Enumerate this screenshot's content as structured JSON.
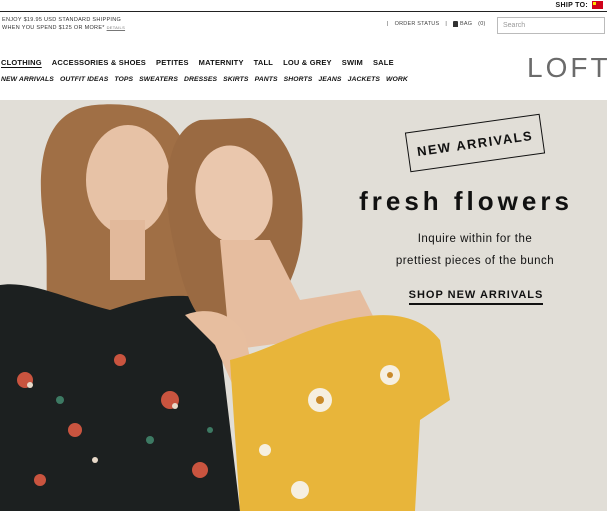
{
  "topbar": {
    "ship_to": "SHIP TO:"
  },
  "promo": {
    "line1": "ENJOY $19.95 USD STANDARD SHIPPING",
    "line2": "WHEN YOU SPEND $125 OR MORE*",
    "details": "DETAILS"
  },
  "utility": {
    "order_status": "ORDER STATUS",
    "bag": "BAG",
    "bag_count": "(0)",
    "search_placeholder": "Search"
  },
  "brand": {
    "logo": "LOFT"
  },
  "nav_primary": [
    "CLOTHING",
    "ACCESSORIES & SHOES",
    "PETITES",
    "MATERNITY",
    "TALL",
    "LOU & GREY",
    "SWIM",
    "SALE"
  ],
  "nav_secondary": [
    "NEW ARRIVALS",
    "OUTFIT IDEAS",
    "TOPS",
    "SWEATERS",
    "DRESSES",
    "SKIRTS",
    "PANTS",
    "SHORTS",
    "JEANS",
    "JACKETS",
    "WORK"
  ],
  "hero": {
    "badge": "NEW ARRIVALS",
    "headline": "fresh flowers",
    "subline1": "Inquire within for the",
    "subline2": "prettiest pieces of the bunch",
    "cta": "SHOP NEW ARRIVALS"
  },
  "colors": {
    "hero_bg": "#e1ded7",
    "dress_yellow": "#e8b53a",
    "dress_black": "#1c2020",
    "flag_red": "#d0021b"
  }
}
